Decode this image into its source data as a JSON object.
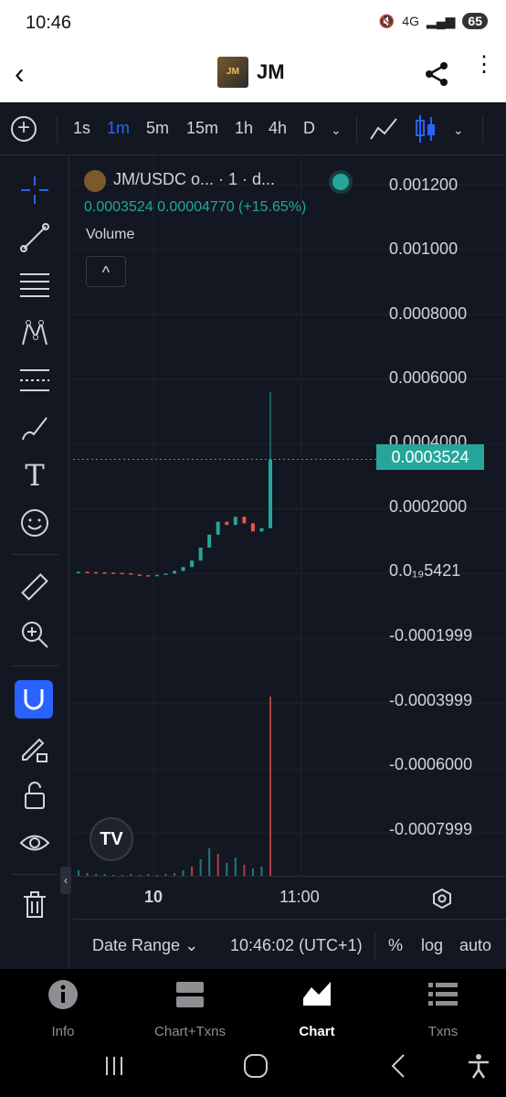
{
  "status": {
    "time": "10:46",
    "network": "4G",
    "battery": "65"
  },
  "appbar": {
    "title": "JM",
    "logo_text": "JM"
  },
  "toolbar": {
    "timeframes": [
      "1s",
      "1m",
      "5m",
      "15m",
      "1h",
      "4h",
      "D"
    ],
    "active_timeframe": "1m"
  },
  "legend": {
    "symbol": "JM/USDC o...  · 1 · d...",
    "values": "0.0003524  0.00004770 (+15.65%)",
    "volume_label": "Volume"
  },
  "price_axis": {
    "labels": [
      "0.001200",
      "0.001000",
      "0.0008000",
      "0.0006000",
      "0.0004000",
      "0.0002000",
      "0.0₁₉5421",
      "-0.0001999",
      "-0.0003999",
      "-0.0006000",
      "-0.0007999"
    ],
    "current_price": "0.0003524"
  },
  "time_axis": {
    "labels": [
      "10",
      "11:00"
    ]
  },
  "bottom_bar": {
    "date_range": "Date Range",
    "clock": "10:46:02 (UTC+1)",
    "percent": "%",
    "log": "log",
    "auto": "auto"
  },
  "nav": {
    "tabs": [
      {
        "label": "Info"
      },
      {
        "label": "Chart+Txns"
      },
      {
        "label": "Chart"
      },
      {
        "label": "Txns"
      }
    ],
    "active": "Chart"
  },
  "colors": {
    "up": "#26a69a",
    "down": "#ef5350",
    "accent": "#2962ff",
    "bg": "#131722"
  },
  "chart_data": {
    "type": "candlestick",
    "title": "",
    "xlabel": "",
    "ylabel": "",
    "ylim": [
      -0.0008,
      0.0012
    ],
    "x_ticks": [
      "10",
      "11:00"
    ],
    "series": [
      {
        "values": [
          5.4e-06,
          4.5e-06,
          4e-06,
          3e-06,
          2e-06,
          1e-06,
          -3e-06,
          -5e-06,
          -6e-06,
          -4e-06,
          0.0,
          8e-06,
          2e-05,
          4e-05,
          8e-05,
          0.00012,
          0.00016,
          0.00015,
          0.000175,
          0.000155,
          0.00013,
          0.00014,
          0.000352
        ]
      }
    ]
  }
}
